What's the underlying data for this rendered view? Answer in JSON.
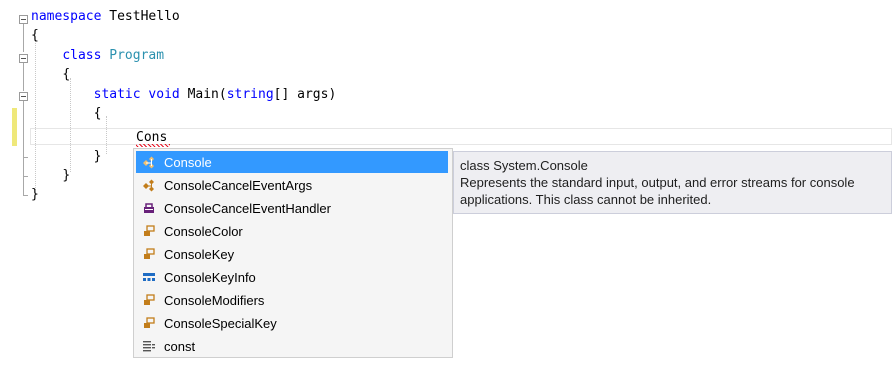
{
  "editor": {
    "lines": [
      {
        "kw": "namespace",
        "text": " TestHello"
      },
      {
        "text": "{"
      },
      {
        "kw": "class",
        "type": "Program"
      },
      {
        "text": "{"
      },
      {
        "kw1": "static",
        "kw2": "void",
        "name": "Main",
        "open": "(",
        "kw3": "string",
        "rest": "[] args)"
      },
      {
        "text": "{"
      },
      {
        "typed": "Cons"
      },
      {
        "text": "}"
      },
      {
        "text": "}"
      },
      {
        "text": "}"
      }
    ]
  },
  "completion": {
    "items": [
      {
        "label": "Console",
        "icon": "class-icon",
        "selected": true
      },
      {
        "label": "ConsoleCancelEventArgs",
        "icon": "class-icon"
      },
      {
        "label": "ConsoleCancelEventHandler",
        "icon": "delegate-icon"
      },
      {
        "label": "ConsoleColor",
        "icon": "enum-icon"
      },
      {
        "label": "ConsoleKey",
        "icon": "enum-icon"
      },
      {
        "label": "ConsoleKeyInfo",
        "icon": "struct-icon"
      },
      {
        "label": "ConsoleModifiers",
        "icon": "enum-icon"
      },
      {
        "label": "ConsoleSpecialKey",
        "icon": "enum-icon"
      },
      {
        "label": "const",
        "icon": "keyword-icon"
      }
    ]
  },
  "tooltip": {
    "signature": "class System.Console",
    "description": "Represents the standard input, output, and error streams for console applications. This class cannot be inherited."
  },
  "colors": {
    "keyword": "#0000ff",
    "type": "#2b91af",
    "selection": "#3399ff",
    "change_marker": "#efe87a"
  }
}
